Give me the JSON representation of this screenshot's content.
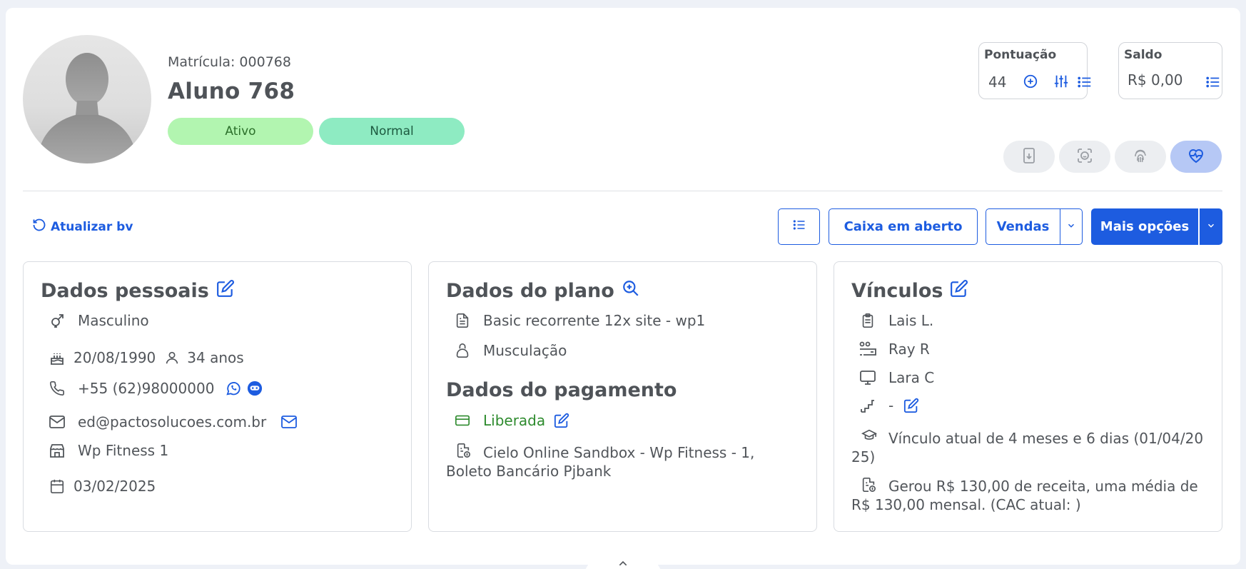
{
  "profile": {
    "matricula": "Matrícula: 000768",
    "name": "Aluno 768",
    "status": "Ativo",
    "category": "Normal"
  },
  "pontuacao": {
    "title": "Pontuação",
    "value": "44"
  },
  "saldo": {
    "title": "Saldo",
    "value": "R$ 0,00"
  },
  "toolbar": {
    "refresh_label": "Atualizar bv",
    "caixa_label": "Caixa em aberto",
    "vendas_label": "Vendas",
    "mais_label": "Mais opções"
  },
  "personal": {
    "title": "Dados pessoais",
    "gender": "Masculino",
    "birthdate": "20/08/1990",
    "age": "34 anos",
    "phone": "+55 (62)98000000",
    "email": "ed@pactosolucoes.com.br",
    "unit": "Wp Fitness 1",
    "date": "03/02/2025"
  },
  "plan": {
    "title": "Dados do plano",
    "plan_name": "Basic recorrente 12x site - wp1",
    "modality": "Musculação",
    "payment_title": "Dados do pagamento",
    "payment_status": "Liberada",
    "payment_methods": "Cielo Online Sandbox - Wp Fitness - 1, Boleto Bancário Pjbank"
  },
  "links": {
    "title": "Vínculos",
    "consultant": "Lais L.",
    "teacher": "Ray R",
    "instructor": "Lara C",
    "level": "-",
    "bond": "Vínculo atual de 4 meses e 6 dias (01/04/2025)",
    "revenue": "Gerou R$ 130,00 de receita, uma média de R$ 130,00 mensal. (CAC atual: )"
  },
  "colors": {
    "accent": "#1d5ce0",
    "ativo": "#b2f5b0",
    "normal": "#8eebc2",
    "green_text": "#2e8b2e"
  }
}
